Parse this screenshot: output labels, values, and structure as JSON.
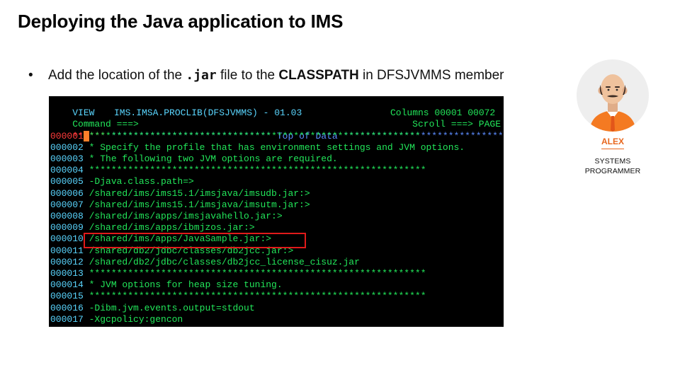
{
  "slide": {
    "title": "Deploying the Java application to IMS",
    "bullet": {
      "marker": "•",
      "text_before": "Add the location of the ",
      "code": ".jar",
      "text_middle": " file to the ",
      "bold": "CLASSPATH",
      "text_after": " in DFSJVMMS member"
    }
  },
  "terminal": {
    "header": {
      "mode": "VIEW",
      "dataset": "IMS.IMSA.PROCLIB(DFSJVMMS) - 01.03",
      "columns": "Columns 00001 00072",
      "command_label": "Command ===>",
      "scroll": "Scroll ===> PAGE"
    },
    "top_marker": "******",
    "top_of_data": " ***************************** Top of Data ******************************",
    "highlighted_line_index": 9,
    "lines": [
      {
        "num": "000001",
        "text": "*************************************************************"
      },
      {
        "num": "000002",
        "text": " * Specify the profile that has environment settings and JVM options."
      },
      {
        "num": "000003",
        "text": " * The following two JVM options are required."
      },
      {
        "num": "000004",
        "text": " *************************************************************"
      },
      {
        "num": "000005",
        "text": " -Djava.class.path=>"
      },
      {
        "num": "000006",
        "text": " /shared/ims/ims15.1/imsjava/imsudb.jar:>"
      },
      {
        "num": "000007",
        "text": " /shared/ims/ims15.1/imsjava/imsutm.jar:>"
      },
      {
        "num": "000008",
        "text": " /shared/ims/apps/imsjavahello.jar:>"
      },
      {
        "num": "000009",
        "text": " /shared/ims/apps/ibmjzos.jar:>"
      },
      {
        "num": "000010",
        "text": " /shared/ims/apps/JavaSample.jar:>"
      },
      {
        "num": "000011",
        "text": " /shared/db2/jdbc/classes/db2jcc.jar:>"
      },
      {
        "num": "000012",
        "text": " /shared/db2/jdbc/classes/db2jcc_license_cisuz.jar"
      },
      {
        "num": "000013",
        "text": " *************************************************************"
      },
      {
        "num": "000014",
        "text": " * JVM options for heap size tuning."
      },
      {
        "num": "000015",
        "text": " *************************************************************"
      },
      {
        "num": "000016",
        "text": " -Dibm.jvm.events.output=stdout"
      },
      {
        "num": "000017",
        "text": " -Xgcpolicy:gencon"
      }
    ]
  },
  "persona": {
    "icon": "person-avatar-icon",
    "name": "ALEX",
    "role_line1": "SYSTEMS",
    "role_line2": "PROGRAMMER"
  },
  "colors": {
    "terminal_bg": "#000000",
    "terminal_green": "#22e65a",
    "terminal_cyan": "#5ad6ff",
    "terminal_blue": "#5c8cff",
    "terminal_red": "#ff3b3b",
    "cursor": "#ff7f2a",
    "highlight_box": "#e01a1a",
    "persona_accent": "#e8671e"
  }
}
